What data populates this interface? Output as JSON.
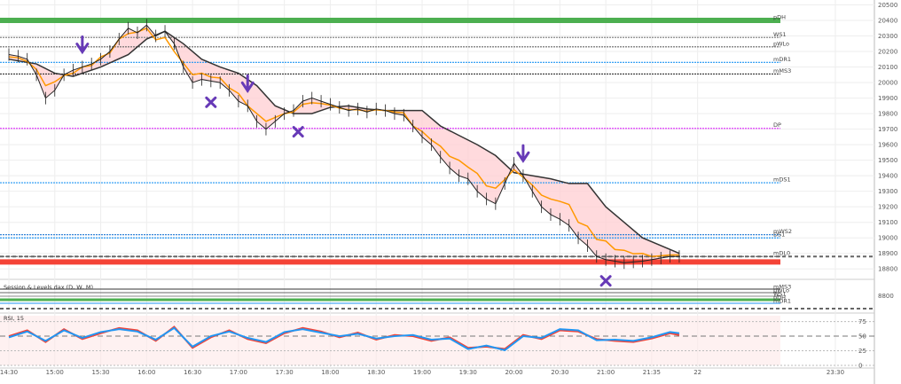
{
  "chart_data": {
    "type": "line",
    "instrument_note": "",
    "x_ticks": [
      "14:30",
      "15:00",
      "15:30",
      "16:00",
      "16:30",
      "17:00",
      "17:30",
      "18:00",
      "18:30",
      "19:00",
      "19:30",
      "20:00",
      "20:30",
      "21:00",
      "21:35",
      "22",
      "23:30"
    ],
    "y_ticks": [
      "20500",
      "20400",
      "20300",
      "20200",
      "20100",
      "20000",
      "19900",
      "19800",
      "19700",
      "19600",
      "19500",
      "19400",
      "19300",
      "19200",
      "19100",
      "19000",
      "18900",
      "18800"
    ],
    "ylim": [
      18750,
      20520
    ],
    "levels": [
      {
        "label": "pDH",
        "value": 20400,
        "color": "#4caf50",
        "thick": true
      },
      {
        "label": "WS1",
        "value": 20290,
        "color": "#888888"
      },
      {
        "label": "pWLo",
        "value": 20230,
        "color": "#666666"
      },
      {
        "label": "mDR1",
        "value": 20130,
        "color": "#2196f3"
      },
      {
        "label": "mMS3",
        "value": 20055,
        "color": "#333333"
      },
      {
        "label": "DP",
        "value": 19705,
        "color": "#e040fb"
      },
      {
        "label": "mDS1",
        "value": 19355,
        "color": "#2196f3"
      },
      {
        "label": "mWS2",
        "value": 19020,
        "color": "#1976d2"
      },
      {
        "label": "DS1",
        "value": 19000,
        "color": "#2196f3"
      },
      {
        "label": "mDL0",
        "value": 18880,
        "color": "#666666"
      },
      {
        "label": "",
        "value": 18845,
        "color": "#f44336",
        "thick": true
      }
    ],
    "price": {
      "x_hours": [
        14.5,
        14.6,
        14.7,
        14.8,
        14.9,
        15.0,
        15.1,
        15.2,
        15.3,
        15.4,
        15.5,
        15.6,
        15.7,
        15.8,
        15.9,
        16.0,
        16.1,
        16.2,
        16.3,
        16.4,
        16.5,
        16.6,
        16.7,
        16.8,
        16.9,
        17.0,
        17.1,
        17.2,
        17.3,
        17.4,
        17.5,
        17.6,
        17.7,
        17.8,
        17.9,
        18.0,
        18.1,
        18.2,
        18.3,
        18.4,
        18.5,
        18.6,
        18.7,
        18.8,
        18.9,
        19.0,
        19.1,
        19.2,
        19.3,
        19.4,
        19.5,
        19.6,
        19.7,
        19.8,
        19.9,
        20.0,
        20.1,
        20.2,
        20.3,
        20.4,
        20.5,
        20.6,
        20.7,
        20.8,
        20.9,
        21.0,
        21.1,
        21.2,
        21.3,
        21.4,
        21.5,
        21.6,
        21.7,
        21.8
      ],
      "values": [
        20180,
        20170,
        20150,
        20050,
        19900,
        19950,
        20050,
        20080,
        20100,
        20120,
        20150,
        20200,
        20280,
        20350,
        20320,
        20370,
        20300,
        20330,
        20250,
        20100,
        20000,
        20020,
        20010,
        20000,
        19950,
        19880,
        19850,
        19750,
        19700,
        19750,
        19800,
        19820,
        19880,
        19900,
        19880,
        19860,
        19840,
        19820,
        19830,
        19810,
        19830,
        19820,
        19800,
        19790,
        19720,
        19650,
        19600,
        19520,
        19450,
        19400,
        19380,
        19300,
        19250,
        19220,
        19350,
        19480,
        19400,
        19300,
        19200,
        19150,
        19120,
        19080,
        19000,
        18950,
        18880,
        18860,
        18850,
        18840,
        18845,
        18850,
        18860,
        18870,
        18880,
        18880
      ]
    },
    "supertrend": {
      "x_hours": [
        14.5,
        14.8,
        15.0,
        15.2,
        15.5,
        15.8,
        16.0,
        16.2,
        16.4,
        16.6,
        16.8,
        17.0,
        17.2,
        17.4,
        17.6,
        17.8,
        18.0,
        18.2,
        18.4,
        18.6,
        18.8,
        19.0,
        19.2,
        19.4,
        19.6,
        19.8,
        20.0,
        20.2,
        20.4,
        20.6,
        20.8,
        21.0,
        21.2,
        21.4,
        21.6,
        21.8
      ],
      "values": [
        20150,
        20120,
        20060,
        20040,
        20100,
        20180,
        20280,
        20330,
        20250,
        20150,
        20100,
        20060,
        19980,
        19850,
        19800,
        19800,
        19840,
        19850,
        19830,
        19820,
        19820,
        19820,
        19720,
        19660,
        19600,
        19530,
        19420,
        19400,
        19380,
        19350,
        19350,
        19200,
        19100,
        19000,
        18950,
        18900
      ]
    },
    "rsi_pane": {
      "title": "RSI, 15",
      "y_ticks": [
        "75",
        "50",
        "25",
        "0"
      ],
      "ylim": [
        0,
        85
      ],
      "x_hours": [
        14.5,
        14.7,
        14.9,
        15.1,
        15.3,
        15.5,
        15.7,
        15.9,
        16.1,
        16.3,
        16.5,
        16.7,
        16.9,
        17.1,
        17.3,
        17.5,
        17.7,
        17.9,
        18.1,
        18.3,
        18.5,
        18.7,
        18.9,
        19.1,
        19.3,
        19.5,
        19.7,
        19.9,
        20.1,
        20.3,
        20.5,
        20.7,
        20.9,
        21.1,
        21.3,
        21.5,
        21.7,
        21.8
      ],
      "series": [
        {
          "values": [
            50,
            60,
            40,
            62,
            45,
            55,
            64,
            60,
            42,
            66,
            30,
            48,
            60,
            45,
            38,
            55,
            64,
            58,
            48,
            56,
            44,
            52,
            50,
            42,
            48,
            30,
            32,
            28,
            52,
            45,
            60,
            58,
            45,
            42,
            40,
            46,
            55,
            52
          ],
          "color": "#f44336"
        },
        {
          "values": [
            48,
            58,
            42,
            60,
            47,
            57,
            62,
            58,
            44,
            64,
            32,
            50,
            58,
            47,
            40,
            57,
            62,
            56,
            50,
            54,
            46,
            50,
            52,
            44,
            46,
            28,
            34,
            26,
            50,
            47,
            62,
            60,
            43,
            44,
            42,
            48,
            57,
            55
          ],
          "color": "#2196f3"
        }
      ]
    },
    "middle_pane": {
      "title": "Session & Levels dax (D, W, M)",
      "y_ticks": [
        "8800"
      ],
      "labels": [
        "mMS3",
        "pWLo",
        "WS1",
        "pDH",
        "mDR1"
      ]
    }
  }
}
